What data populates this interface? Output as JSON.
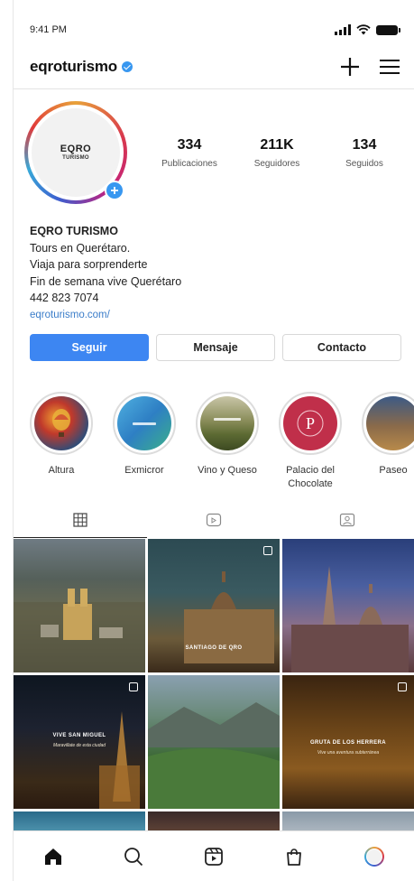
{
  "status_bar": {
    "time": "9:41 PM"
  },
  "header": {
    "username": "eqroturismo"
  },
  "profile": {
    "logo_text": "EQRO",
    "logo_sub": "TURISMO",
    "stats": [
      {
        "value": "334",
        "label": "Publicaciones"
      },
      {
        "value": "211K",
        "label": "Seguidores"
      },
      {
        "value": "134",
        "label": "Seguidos"
      }
    ]
  },
  "bio": {
    "name": "EQRO TURISMO",
    "line1": "Tours en Querétaro.",
    "line2": "Viaja para sorprenderte",
    "line3": "Fin de semana vive Querétaro",
    "phone": "442 823 7074",
    "link": "eqroturismo.com/"
  },
  "buttons": {
    "follow": "Seguir",
    "message": "Mensaje",
    "contact": "Contacto"
  },
  "highlights": [
    {
      "label": "Altura",
      "label2": ""
    },
    {
      "label": "Exmicror",
      "label2": ""
    },
    {
      "label": "Vino y Queso",
      "label2": ""
    },
    {
      "label": "Palacio del",
      "label2": "Chocolate"
    },
    {
      "label": "Paseo",
      "label2": ""
    }
  ],
  "posts": [
    {
      "caption": "",
      "subcaption": ""
    },
    {
      "caption": "SANTIAGO DE QRO",
      "subcaption": ""
    },
    {
      "caption": "",
      "subcaption": ""
    },
    {
      "caption": "VIVE SAN MIGUEL",
      "subcaption": "Maravillate de esta ciudad"
    },
    {
      "caption": "",
      "subcaption": ""
    },
    {
      "caption": "GRUTA DE LOS HERRERA",
      "subcaption": "Vive una aventura subterránea"
    }
  ],
  "colors": {
    "primary": "#3d86f2",
    "verified": "#3897f0",
    "link": "#3b7dc9"
  }
}
